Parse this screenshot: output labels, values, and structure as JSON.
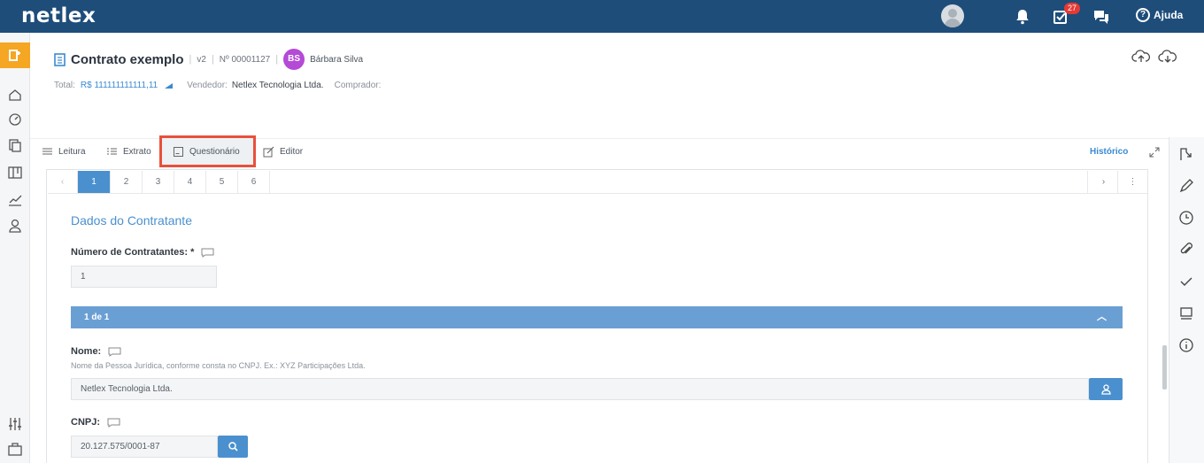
{
  "app": {
    "logo": "netlex",
    "notifications_count": "27",
    "help_label": "Ajuda",
    "help_icon_glyph": "?"
  },
  "document": {
    "title": "Contrato exemplo",
    "version": "v2",
    "number": "Nº 00001127",
    "owner_initials": "BS",
    "owner_name": "Bárbara Silva",
    "total_label": "Total:",
    "total_value": "R$ 111111111111,11",
    "seller_label": "Vendedor:",
    "seller_value": "Netlex Tecnologia Ltda.",
    "buyer_label": "Comprador:",
    "buyer_value": ""
  },
  "tabs": [
    {
      "label": "Leitura",
      "icon": "lines-icon"
    },
    {
      "label": "Extrato",
      "icon": "list-icon"
    },
    {
      "label": "Questionário",
      "icon": "form-icon",
      "selected": true
    },
    {
      "label": "Editor",
      "icon": "edit-icon"
    }
  ],
  "history_label": "Histórico",
  "pager": {
    "prev": "‹",
    "pages": [
      "1",
      "2",
      "3",
      "4",
      "5",
      "6"
    ],
    "active_page": "1",
    "next": "›",
    "more": "⋮"
  },
  "form": {
    "section_title": "Dados do Contratante",
    "num_contratantes_label": "Número de Contratantes: *",
    "num_contratantes_value": "1",
    "group_header": "1 de 1",
    "group_chevron": "︿",
    "nome_label": "Nome:",
    "nome_hint": "Nome da Pessoa Jurídica, conforme consta no CNPJ. Ex.: XYZ Participações Ltda.",
    "nome_value": "Netlex Tecnologia Ltda.",
    "cnpj_label": "CNPJ:",
    "cnpj_value": "20.127.575/0001-87"
  },
  "colors": {
    "topbar": "#1e4d7a",
    "accent": "#4a90cf",
    "active_left": "#f5a623",
    "highlight_border": "#e8503c",
    "avatar": "#b44ad6"
  }
}
